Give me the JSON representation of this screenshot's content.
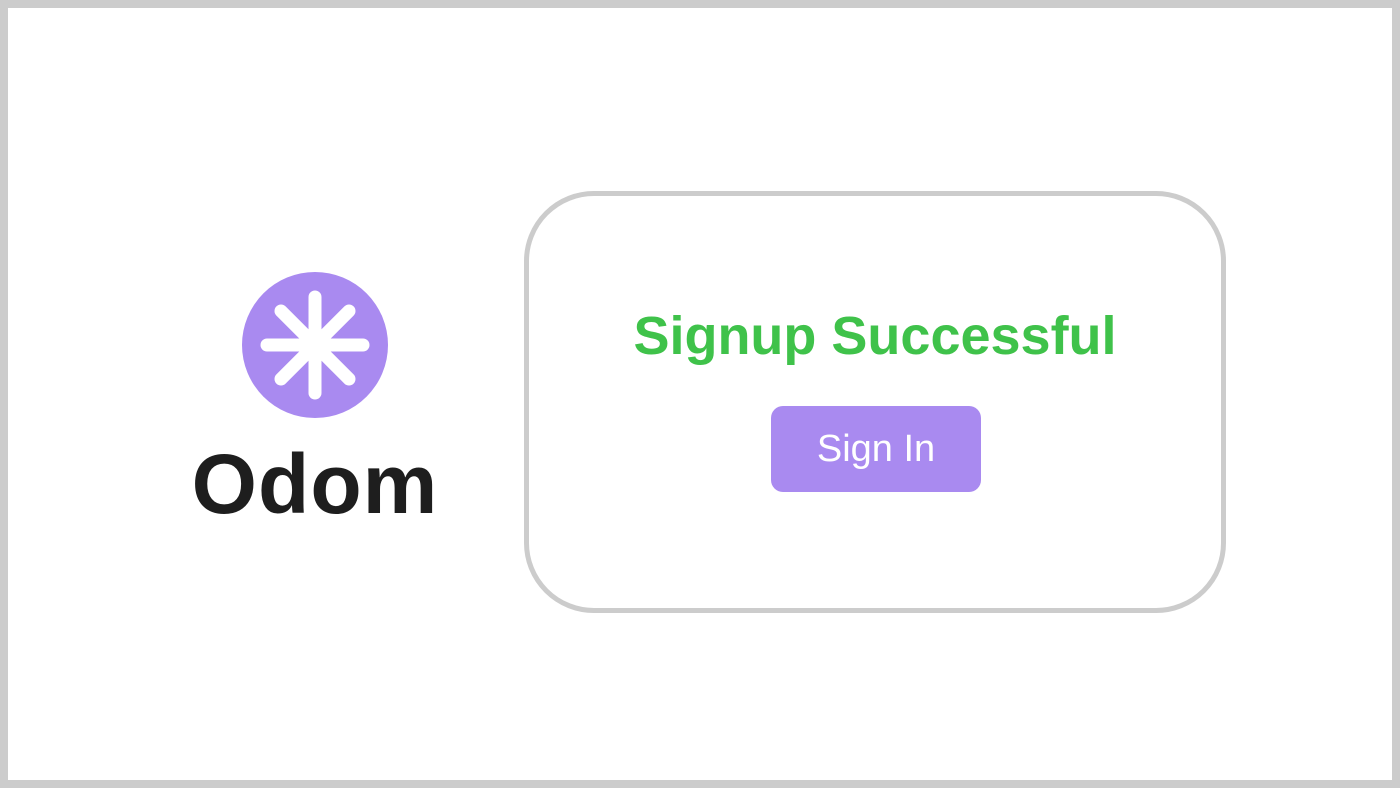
{
  "brand": {
    "name": "Odom",
    "logo_icon": "asterisk-icon"
  },
  "card": {
    "title": "Signup Successful",
    "signin_label": "Sign In"
  },
  "colors": {
    "accent": "#a98af0",
    "success": "#3fc24a",
    "brand_text": "#1e1e1e",
    "border": "#cccccc"
  }
}
